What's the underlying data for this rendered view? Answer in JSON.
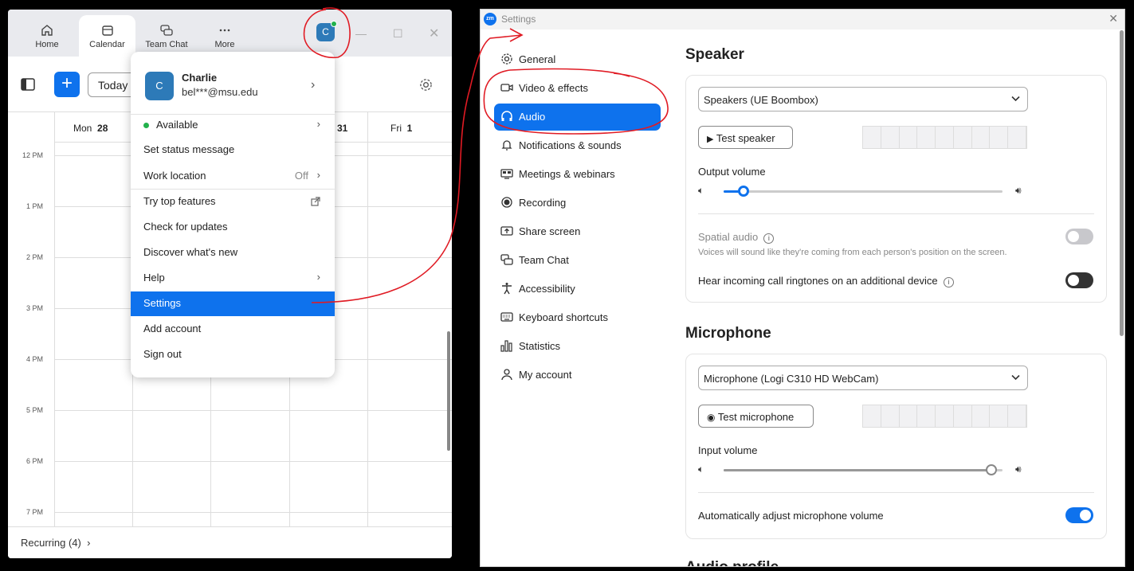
{
  "left_window": {
    "tabs": [
      {
        "label": "Home",
        "icon": "home-icon"
      },
      {
        "label": "Calendar",
        "icon": "calendar-icon"
      },
      {
        "label": "Team Chat",
        "icon": "chat-icon"
      },
      {
        "label": "More",
        "icon": "more-icon"
      }
    ],
    "avatar_letter": "C",
    "today_label": "Today",
    "days": [
      {
        "name": "Mon",
        "num": "28"
      },
      {
        "name": "",
        "num": "31"
      },
      {
        "name": "Fri",
        "num": "1"
      }
    ],
    "times": [
      "12 PM",
      "1 PM",
      "2 PM",
      "3 PM",
      "4 PM",
      "5 PM",
      "6 PM",
      "7 PM"
    ],
    "recurring_label": "Recurring (4)"
  },
  "profile_menu": {
    "name": "Charlie",
    "email": "bel***@msu.edu",
    "avatar_letter": "C",
    "status": "Available",
    "set_status": "Set status message",
    "work_location": "Work location",
    "work_location_value": "Off",
    "items": [
      "Try top features",
      "Check for updates",
      "Discover what's new",
      "Help",
      "Settings",
      "Add account",
      "Sign out"
    ]
  },
  "settings": {
    "title": "Settings",
    "logo_text": "zm",
    "nav": [
      {
        "label": "General",
        "icon": "gear-icon"
      },
      {
        "label": "Video & effects",
        "icon": "video-icon"
      },
      {
        "label": "Audio",
        "icon": "headphones-icon"
      },
      {
        "label": "Notifications & sounds",
        "icon": "bell-icon"
      },
      {
        "label": "Meetings & webinars",
        "icon": "meetings-icon"
      },
      {
        "label": "Recording",
        "icon": "record-icon"
      },
      {
        "label": "Share screen",
        "icon": "share-screen-icon"
      },
      {
        "label": "Team Chat",
        "icon": "chat-icon"
      },
      {
        "label": "Accessibility",
        "icon": "accessibility-icon"
      },
      {
        "label": "Keyboard shortcuts",
        "icon": "keyboard-icon"
      },
      {
        "label": "Statistics",
        "icon": "statistics-icon"
      },
      {
        "label": "My account",
        "icon": "person-icon"
      }
    ],
    "speaker": {
      "heading": "Speaker",
      "device": "Speakers (UE Boombox)",
      "test_button": "Test speaker",
      "output_volume_label": "Output volume",
      "output_volume": 0.07,
      "spatial_audio_label": "Spatial audio",
      "spatial_audio_desc": "Voices will sound like they're coming from each person's position on the screen.",
      "spatial_audio_on": false,
      "ringtone_label": "Hear incoming call ringtones on an additional device",
      "ringtone_on": false
    },
    "microphone": {
      "heading": "Microphone",
      "device": "Microphone (Logi C310 HD WebCam)",
      "test_button": "Test microphone",
      "input_volume_label": "Input volume",
      "input_volume": 0.96,
      "auto_adjust_label": "Automatically adjust microphone volume",
      "auto_adjust_on": true
    },
    "next_heading": "Audio profile"
  },
  "colors": {
    "accent": "#0e72ed",
    "annotation": "#e01b24",
    "available": "#22b14c"
  }
}
